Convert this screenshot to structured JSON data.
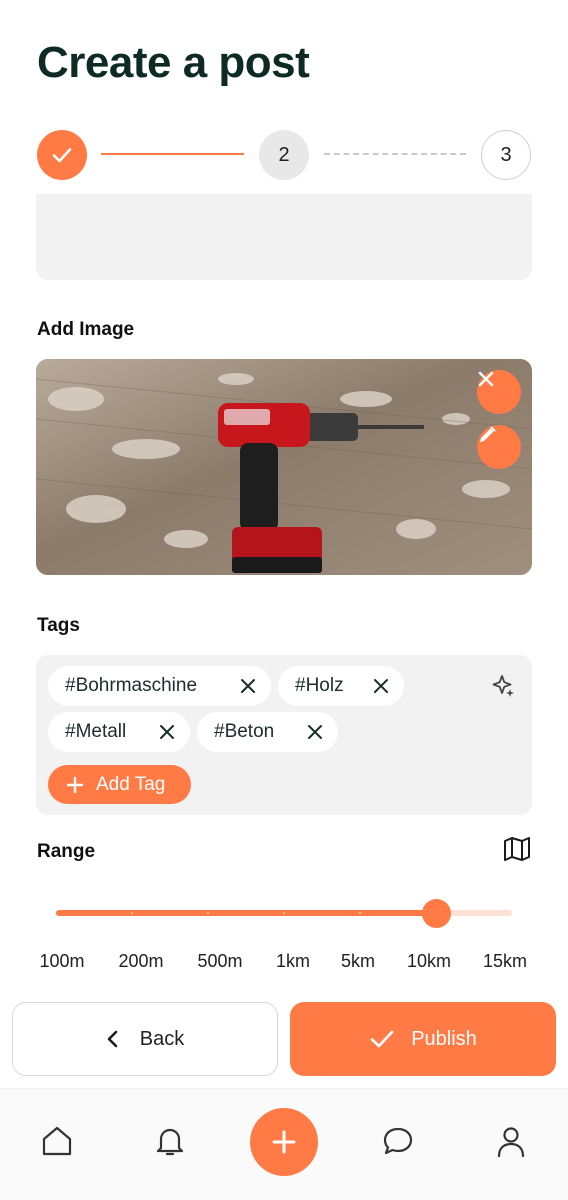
{
  "page": {
    "title": "Create a post"
  },
  "stepper": {
    "steps": [
      {
        "label": "",
        "state": "done"
      },
      {
        "label": "2",
        "state": "current"
      },
      {
        "label": "3",
        "state": "pending"
      }
    ]
  },
  "image_section": {
    "label": "Add Image",
    "image_alt": "red cordless drill on a wooden floor"
  },
  "tags_section": {
    "label": "Tags",
    "tags": [
      "#Bohrmaschine",
      "#Holz",
      "#Metall",
      "#Beton"
    ],
    "add_label": "Add Tag"
  },
  "range_section": {
    "label": "Range",
    "ticks": [
      "100m",
      "200m",
      "500m",
      "1km",
      "5km",
      "10km",
      "15km"
    ],
    "selected": "10km",
    "selected_index": 5
  },
  "actions": {
    "back_label": "Back",
    "publish_label": "Publish"
  },
  "bottom_nav": {
    "items": [
      "home-icon",
      "bell-icon",
      "plus-icon",
      "chat-icon",
      "profile-icon"
    ]
  },
  "colors": {
    "accent": "#ff7a45",
    "accent_light": "#fde1d4",
    "surface": "#f2f2f2",
    "title": "#0e2a24"
  }
}
